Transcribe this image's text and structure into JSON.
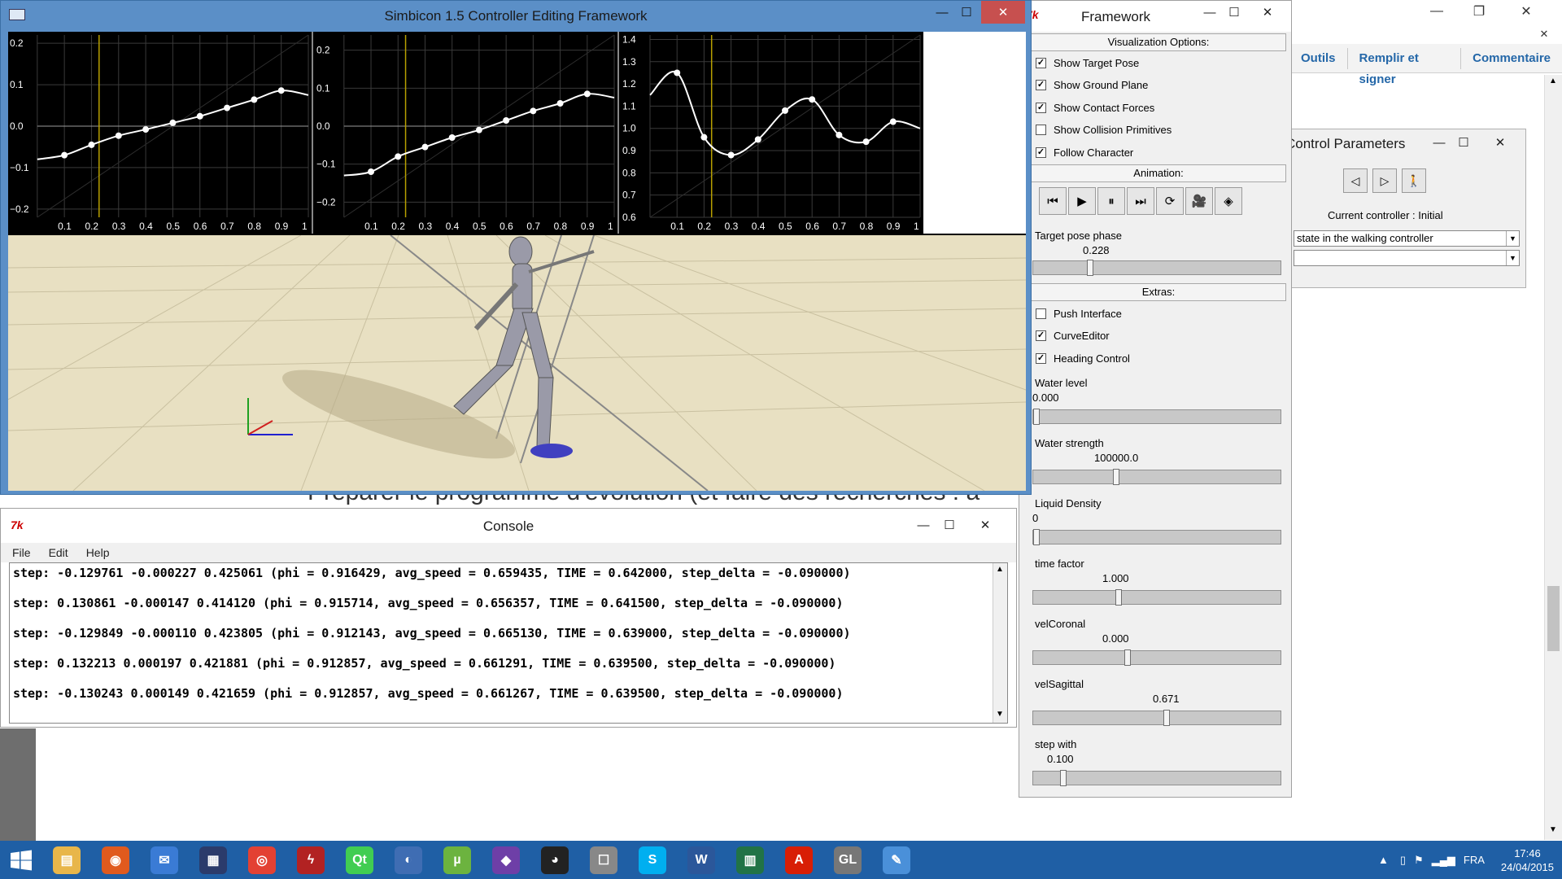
{
  "main_window": {
    "title": "Simbicon 1.5 Controller Editing Framework"
  },
  "plots": [
    {
      "y_ticks": [
        "0.2",
        "0.1",
        "0.0",
        "−0.1",
        "−0.2"
      ],
      "x_ticks": [
        "0.1",
        "0.2",
        "0.3",
        "0.4",
        "0.5",
        "0.6",
        "0.7",
        "0.8",
        "0.9",
        "1"
      ],
      "ylim": [
        -0.22,
        0.22
      ],
      "points": [
        [
          0.0,
          -0.08
        ],
        [
          0.1,
          -0.07
        ],
        [
          0.2,
          -0.045
        ],
        [
          0.3,
          -0.023
        ],
        [
          0.4,
          -0.008
        ],
        [
          0.5,
          0.008
        ],
        [
          0.6,
          0.024
        ],
        [
          0.7,
          0.044
        ],
        [
          0.8,
          0.064
        ],
        [
          0.9,
          0.086
        ],
        [
          1.0,
          0.075
        ]
      ]
    },
    {
      "y_ticks": [
        "0.2",
        "0.1",
        "0.0",
        "−0.1",
        "−0.2"
      ],
      "x_ticks": [
        "0.1",
        "0.2",
        "0.3",
        "0.4",
        "0.5",
        "0.6",
        "0.7",
        "0.8",
        "0.9",
        "1"
      ],
      "ylim": [
        -0.24,
        0.24
      ],
      "points": [
        [
          0.0,
          -0.13
        ],
        [
          0.1,
          -0.12
        ],
        [
          0.2,
          -0.08
        ],
        [
          0.3,
          -0.055
        ],
        [
          0.4,
          -0.03
        ],
        [
          0.5,
          -0.01
        ],
        [
          0.6,
          0.015
        ],
        [
          0.7,
          0.04
        ],
        [
          0.8,
          0.06
        ],
        [
          0.9,
          0.085
        ],
        [
          1.0,
          0.075
        ]
      ]
    },
    {
      "y_ticks": [
        "1.4",
        "1.3",
        "1.2",
        "1.1",
        "1.0",
        "0.9",
        "0.8",
        "0.7",
        "0.6"
      ],
      "x_ticks": [
        "0.1",
        "0.2",
        "0.3",
        "0.4",
        "0.5",
        "0.6",
        "0.7",
        "0.8",
        "0.9",
        "1"
      ],
      "ylim": [
        0.6,
        1.42
      ],
      "points": [
        [
          0.0,
          1.15
        ],
        [
          0.1,
          1.25
        ],
        [
          0.2,
          0.96
        ],
        [
          0.3,
          0.88
        ],
        [
          0.4,
          0.95
        ],
        [
          0.5,
          1.08
        ],
        [
          0.6,
          1.13
        ],
        [
          0.7,
          0.97
        ],
        [
          0.8,
          0.94
        ],
        [
          0.9,
          1.03
        ],
        [
          1.0,
          1.0
        ]
      ]
    }
  ],
  "framework": {
    "title": "Framework",
    "visualization_header": "Visualization Options:",
    "checkboxes": [
      {
        "label": "Show Target Pose",
        "checked": true
      },
      {
        "label": "Show Ground Plane",
        "checked": true
      },
      {
        "label": "Show Contact Forces",
        "checked": true
      },
      {
        "label": "Show Collision Primitives",
        "checked": false
      },
      {
        "label": "Follow Character",
        "checked": true
      }
    ],
    "animation_header": "Animation:",
    "target_pose_phase": {
      "label": "Target pose phase",
      "value": "0.228"
    },
    "extras_header": "Extras:",
    "extras": [
      {
        "label": "Push Interface",
        "checked": false
      },
      {
        "label": "CurveEditor",
        "checked": true
      },
      {
        "label": "Heading Control",
        "checked": true
      }
    ],
    "sliders": [
      {
        "label": "Water level",
        "value": "0.000",
        "fraction": 0.0
      },
      {
        "label": "Water strength",
        "value": "100000.0",
        "fraction": 0.33
      },
      {
        "label": "Liquid Density",
        "value": "0",
        "fraction": 0.0
      },
      {
        "label": "time factor",
        "value": "1.000",
        "fraction": 0.34
      },
      {
        "label": "velCoronal",
        "value": "0.000",
        "fraction": 0.38
      },
      {
        "label": "velSagittal",
        "value": "0.671",
        "fraction": 0.54
      },
      {
        "label": "step with",
        "value": "0.100",
        "fraction": 0.11
      }
    ]
  },
  "control_params": {
    "title": "Control Parameters",
    "current_label": "Current controller :  Initial",
    "combo1": "state in the walking controller",
    "combo2": ""
  },
  "pdf": {
    "tools": [
      "Outils",
      "Remplir et signer",
      "Commentaire"
    ]
  },
  "doc_text": "Préparer le programme d'évolution (et faire des recherches : a",
  "console": {
    "title": "Console",
    "menu": [
      "File",
      "Edit",
      "Help"
    ],
    "lines": [
      "step: -0.129761 -0.000227 0.425061 (phi = 0.916429, avg_speed = 0.659435, TIME = 0.642000, step_delta = -0.090000)",
      "step: 0.130861 -0.000147 0.414120 (phi = 0.915714, avg_speed = 0.656357, TIME = 0.641500, step_delta = -0.090000)",
      "step: -0.129849 -0.000110 0.423805 (phi = 0.912143, avg_speed = 0.665130, TIME = 0.639000, step_delta = -0.090000)",
      "step: 0.132213 0.000197 0.421881 (phi = 0.912857, avg_speed = 0.661291, TIME = 0.639500, step_delta = -0.090000)",
      "step: -0.130243 0.000149 0.421659 (phi = 0.912857, avg_speed = 0.661267, TIME = 0.639500, step_delta = -0.090000)"
    ]
  },
  "taskbar": {
    "apps": [
      "file-explorer",
      "firefox",
      "thunderbird",
      "network-app",
      "chrome",
      "antivirus",
      "qt-creator",
      "app-spiral",
      "utorrent",
      "visual-studio",
      "github",
      "joystick-app",
      "skype",
      "word",
      "sheet-app",
      "acrobat",
      "opengl-app",
      "paint"
    ],
    "lang": "FRA",
    "time": "17:46",
    "date": "24/04/2015"
  },
  "colors": {
    "title_blue": "#5b8fc7",
    "taskbar": "#1f5fa5",
    "close_red": "#c7504f"
  }
}
